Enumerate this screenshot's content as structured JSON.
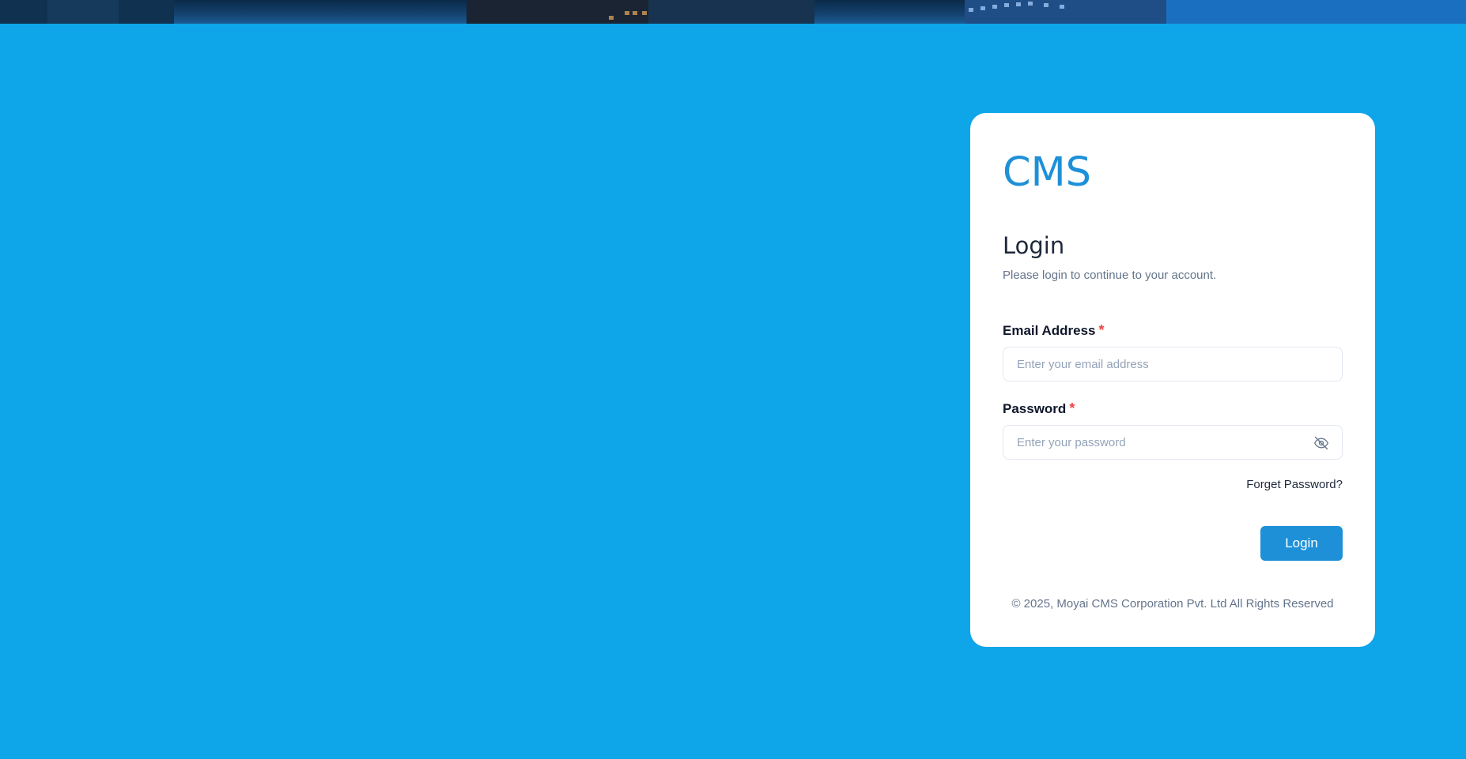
{
  "brand": {
    "name": "CMS"
  },
  "login": {
    "title": "Login",
    "subtitle": "Please login to continue to your account.",
    "email": {
      "label": "Email Address",
      "required_mark": "*",
      "placeholder": "Enter your email address",
      "value": ""
    },
    "password": {
      "label": "Password",
      "required_mark": "*",
      "placeholder": "Enter your password",
      "value": "",
      "toggle_icon": "eye-off-icon"
    },
    "forgot_label": "Forget Password?",
    "submit_label": "Login"
  },
  "footer": {
    "copyright": "© 2025, Moyai CMS Corporation Pvt. Ltd All Rights Reserved"
  },
  "colors": {
    "background": "#0ea5e9",
    "accent": "#1e90d8",
    "required": "#ef4444",
    "card": "#ffffff"
  }
}
